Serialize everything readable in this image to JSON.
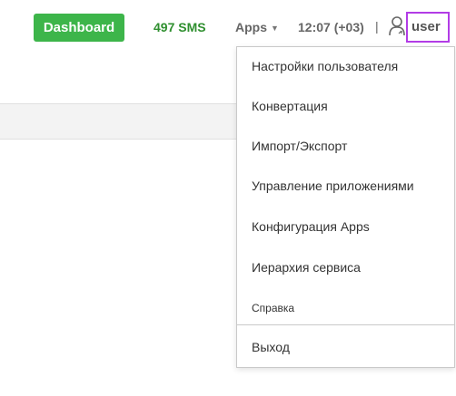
{
  "header": {
    "dashboard_label": "Dashboard",
    "sms_count": "497 SMS",
    "apps_label": "Apps",
    "clock": "12:07 (+03)",
    "separator": "|",
    "username": "user",
    "user_icon": "person-icon",
    "caret_icon": "caret-down-icon"
  },
  "colors": {
    "dashboard_bg": "#3db54a",
    "sms_text": "#2f8f2f",
    "highlight_border": "#b23ce6"
  },
  "user_menu": {
    "items": [
      "Настройки пользователя",
      "Конвертация",
      "Импорт/Экспорт",
      "Управление приложениями",
      "Конфигурация Apps",
      "Иерархия сервиса",
      "Справка"
    ],
    "logout_label": "Выход"
  }
}
